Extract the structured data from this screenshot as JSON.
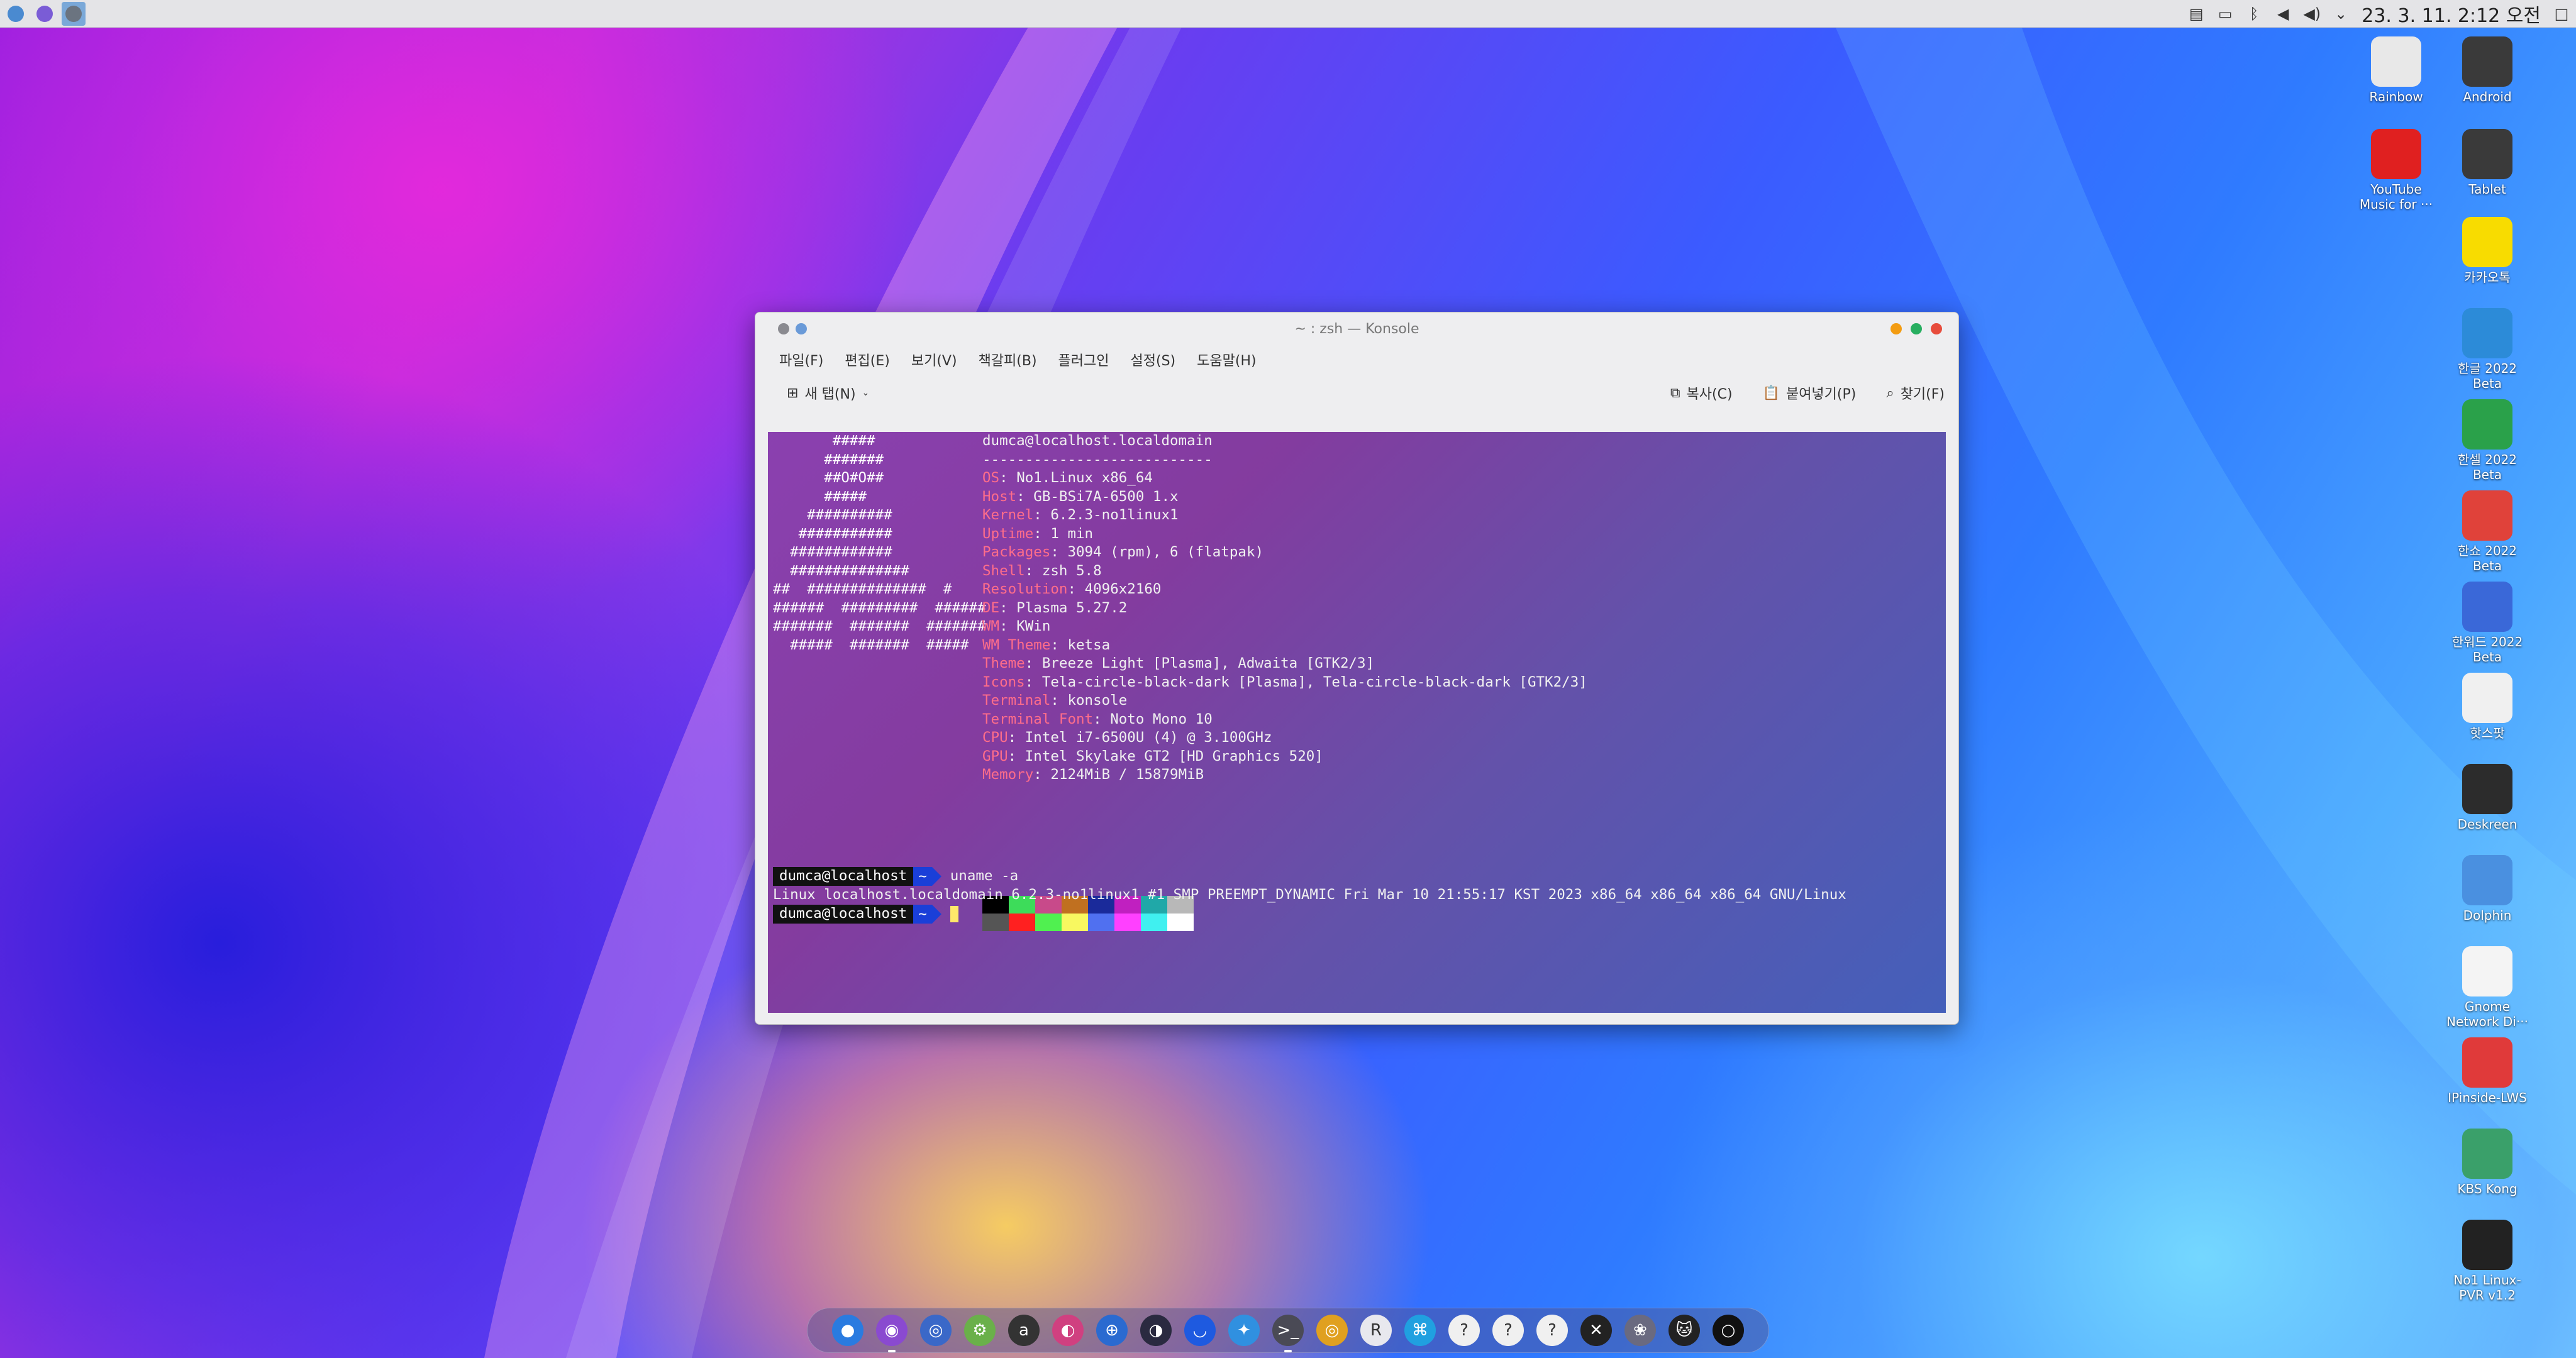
{
  "top_panel": {
    "apps": [
      {
        "icon": "kde-connect-icon",
        "color": "#4a8ad0"
      },
      {
        "icon": "firefox-icon",
        "color": "#7a5cd6"
      },
      {
        "icon": "konsole-icon",
        "color": "#6b7480"
      }
    ],
    "tray_icons": [
      "clipboard-icon",
      "display-icon",
      "bluetooth-icon",
      "volume-icon",
      "volume-high-icon",
      "chevron-down-icon"
    ],
    "clock": "23. 3. 11.  2:12 오전"
  },
  "desktop_icons": [
    {
      "label": "Rainbow",
      "icon": "rainbow-app-icon",
      "color": "#e8e8e8"
    },
    {
      "label": "Android",
      "icon": "folder-icon",
      "color": "#3a3a3a"
    },
    {
      "label": "YouTube\nMusic for ···",
      "icon": "youtube-music-icon",
      "color": "#e02020"
    },
    {
      "label": "Tablet",
      "icon": "folder-icon",
      "color": "#3a3a3a"
    },
    {
      "label": "카카오톡",
      "icon": "kakaotalk-icon",
      "color": "#f8dc00"
    },
    {
      "label": "한글 2022\nBeta",
      "icon": "hangul-icon",
      "color": "#2c8bd8"
    },
    {
      "label": "한셀 2022\nBeta",
      "icon": "hancell-icon",
      "color": "#2aa14a"
    },
    {
      "label": "한쇼 2022\nBeta",
      "icon": "hanshow-icon",
      "color": "#e0423a"
    },
    {
      "label": "한워드 2022\nBeta",
      "icon": "hanword-icon",
      "color": "#3a68d8"
    },
    {
      "label": "핫스팟",
      "icon": "hotspot-icon",
      "color": "#f0f0f0"
    },
    {
      "label": "Deskreen",
      "icon": "deskreen-icon",
      "color": "#2c2c2c"
    },
    {
      "label": "Dolphin",
      "icon": "dolphin-icon",
      "color": "#4a90e0"
    },
    {
      "label": "Gnome\nNetwork Di···",
      "icon": "unknown-app-icon",
      "color": "#f4f4f4"
    },
    {
      "label": "IPinside-LWS",
      "icon": "ipinside-icon",
      "color": "#e03a3a"
    },
    {
      "label": "KBS Kong",
      "icon": "kbs-kong-icon",
      "color": "#3aa06a"
    },
    {
      "label": "No1 Linux-\nPVR v1.2",
      "icon": "pvr-icon",
      "color": "#222222"
    }
  ],
  "window": {
    "title": "~ : zsh — Konsole",
    "menu": [
      "파일(F)",
      "편집(E)",
      "보기(V)",
      "책갈피(B)",
      "플러그인",
      "설정(S)",
      "도움말(H)"
    ],
    "toolbar": {
      "new_tab": "새 탭(N)",
      "copy": "복사(C)",
      "paste": "붙여넣기(P)",
      "find": "찾기(F)"
    }
  },
  "terminal": {
    "ascii_art": [
      "       #####",
      "      #######",
      "      ##O#O##",
      "      #####",
      "    ##########",
      "   ###########",
      "  ############",
      "  ##############",
      "##  ##############  #",
      "######  #########  ######",
      "#######  #######  #######",
      "  #####  #######  #####"
    ],
    "header": "dumca@localhost.localdomain",
    "separator": "---------------------------",
    "info": [
      {
        "key": "OS",
        "value": "No1.Linux x86_64"
      },
      {
        "key": "Host",
        "value": "GB-BSi7A-6500 1.x"
      },
      {
        "key": "Kernel",
        "value": "6.2.3-no1linux1"
      },
      {
        "key": "Uptime",
        "value": "1 min"
      },
      {
        "key": "Packages",
        "value": "3094 (rpm), 6 (flatpak)"
      },
      {
        "key": "Shell",
        "value": "zsh 5.8"
      },
      {
        "key": "Resolution",
        "value": "4096x2160"
      },
      {
        "key": "DE",
        "value": "Plasma 5.27.2"
      },
      {
        "key": "WM",
        "value": "KWin"
      },
      {
        "key": "WM Theme",
        "value": "ketsa"
      },
      {
        "key": "Theme",
        "value": "Breeze Light [Plasma], Adwaita [GTK2/3]"
      },
      {
        "key": "Icons",
        "value": "Tela-circle-black-dark [Plasma], Tela-circle-black-dark [GTK2/3]"
      },
      {
        "key": "Terminal",
        "value": "konsole"
      },
      {
        "key": "Terminal Font",
        "value": "Noto Mono 10"
      },
      {
        "key": "CPU",
        "value": "Intel i7-6500U (4) @ 3.100GHz"
      },
      {
        "key": "GPU",
        "value": "Intel Skylake GT2 [HD Graphics 520]"
      },
      {
        "key": "Memory",
        "value": "2124MiB / 15879MiB"
      }
    ],
    "palette": [
      "#000000",
      "#3ddc5a",
      "#c84a8a",
      "#c07020",
      "#1a2a9a",
      "#c020c0",
      "#20a8a8",
      "#b8b8b8",
      "#555555",
      "#ff2020",
      "#50f050",
      "#f8f860",
      "#5070f0",
      "#ff40ff",
      "#40f0f0",
      "#ffffff"
    ],
    "prompt_user": "dumca@localhost",
    "prompt_dir": "~",
    "command": "uname -a",
    "output": "Linux localhost.localdomain 6.2.3-no1linux1 #1 SMP PREEMPT_DYNAMIC Fri Mar 10 21:55:17 KST 2023 x86_64 x86_64 x86_64 GNU/Linux"
  },
  "dock": [
    {
      "icon": "finder-icon",
      "color": "#2a7be0",
      "glyph": "●",
      "running": false
    },
    {
      "icon": "firefox-icon",
      "color": "#8a4ad0",
      "glyph": "◉",
      "running": true
    },
    {
      "icon": "browser-icon",
      "color": "#3a68c8",
      "glyph": "◎",
      "running": false
    },
    {
      "icon": "settings-icon",
      "color": "#6ab04a",
      "glyph": "⚙",
      "running": false
    },
    {
      "icon": "app-a-icon",
      "color": "#333333",
      "glyph": "a",
      "running": false
    },
    {
      "icon": "color-app-icon",
      "color": "#d04080",
      "glyph": "◐",
      "running": false
    },
    {
      "icon": "network-icon",
      "color": "#2a6ad0",
      "glyph": "⊕",
      "running": false
    },
    {
      "icon": "daemon-icon",
      "color": "#2a2a40",
      "glyph": "◑",
      "running": false
    },
    {
      "icon": "smile-app-icon",
      "color": "#1e5ae0",
      "glyph": "◡",
      "running": false
    },
    {
      "icon": "kdeconnect-icon",
      "color": "#3090e0",
      "glyph": "✦",
      "running": false
    },
    {
      "icon": "terminal-icon",
      "color": "#4a4a55",
      "glyph": ">_",
      "running": true
    },
    {
      "icon": "record-icon",
      "color": "#e0a020",
      "glyph": "◎",
      "running": false
    },
    {
      "icon": "r-app-icon",
      "color": "#e8e8ee",
      "glyph": "R",
      "running": false
    },
    {
      "icon": "flutter-icon",
      "color": "#20a0e0",
      "glyph": "⌘",
      "running": false
    },
    {
      "icon": "unknown-app-icon",
      "color": "#f0f0f0",
      "glyph": "?",
      "running": false
    },
    {
      "icon": "unknown-app-icon",
      "color": "#f0f0f0",
      "glyph": "?",
      "running": false
    },
    {
      "icon": "unknown-app-icon",
      "color": "#f0f0f0",
      "glyph": "?",
      "running": false
    },
    {
      "icon": "x-app-icon",
      "color": "#222222",
      "glyph": "✕",
      "running": false
    },
    {
      "icon": "cluster-icon",
      "color": "#6a6a80",
      "glyph": "❀",
      "running": false
    },
    {
      "icon": "cat-app-icon",
      "color": "#222222",
      "glyph": "🐱",
      "running": false
    },
    {
      "icon": "circle-app-icon",
      "color": "#111111",
      "glyph": "○",
      "running": false
    }
  ]
}
